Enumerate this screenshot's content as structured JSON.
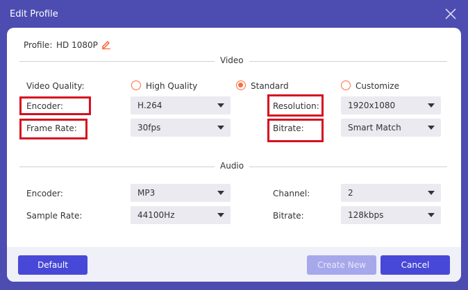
{
  "window": {
    "title": "Edit Profile",
    "close_icon": "close-icon"
  },
  "profile": {
    "label": "Profile:",
    "name": "HD 1080P",
    "edit_icon": "pencil-icon"
  },
  "video": {
    "section_title": "Video",
    "quality_label": "Video Quality:",
    "quality_options": [
      {
        "label": "High Quality",
        "checked": false
      },
      {
        "label": "Standard",
        "checked": true
      },
      {
        "label": "Customize",
        "checked": false
      }
    ],
    "encoder_label": "Encoder:",
    "encoder_value": "H.264",
    "frame_rate_label": "Frame Rate:",
    "frame_rate_value": "30fps",
    "resolution_label": "Resolution:",
    "resolution_value": "1920x1080",
    "bitrate_label": "Bitrate:",
    "bitrate_value": "Smart Match"
  },
  "audio": {
    "section_title": "Audio",
    "encoder_label": "Encoder:",
    "encoder_value": "MP3",
    "sample_rate_label": "Sample Rate:",
    "sample_rate_value": "44100Hz",
    "channel_label": "Channel:",
    "channel_value": "2",
    "bitrate_label": "Bitrate:",
    "bitrate_value": "128kbps"
  },
  "footer": {
    "default_label": "Default",
    "create_new_label": "Create New",
    "cancel_label": "Cancel"
  },
  "colors": {
    "titlebar": "#4c4cb1",
    "accent_radio": "#ff6a3d",
    "button_primary": "#4848d8",
    "button_disabled": "#a7a7ec",
    "highlight_box": "#d60f1f"
  }
}
